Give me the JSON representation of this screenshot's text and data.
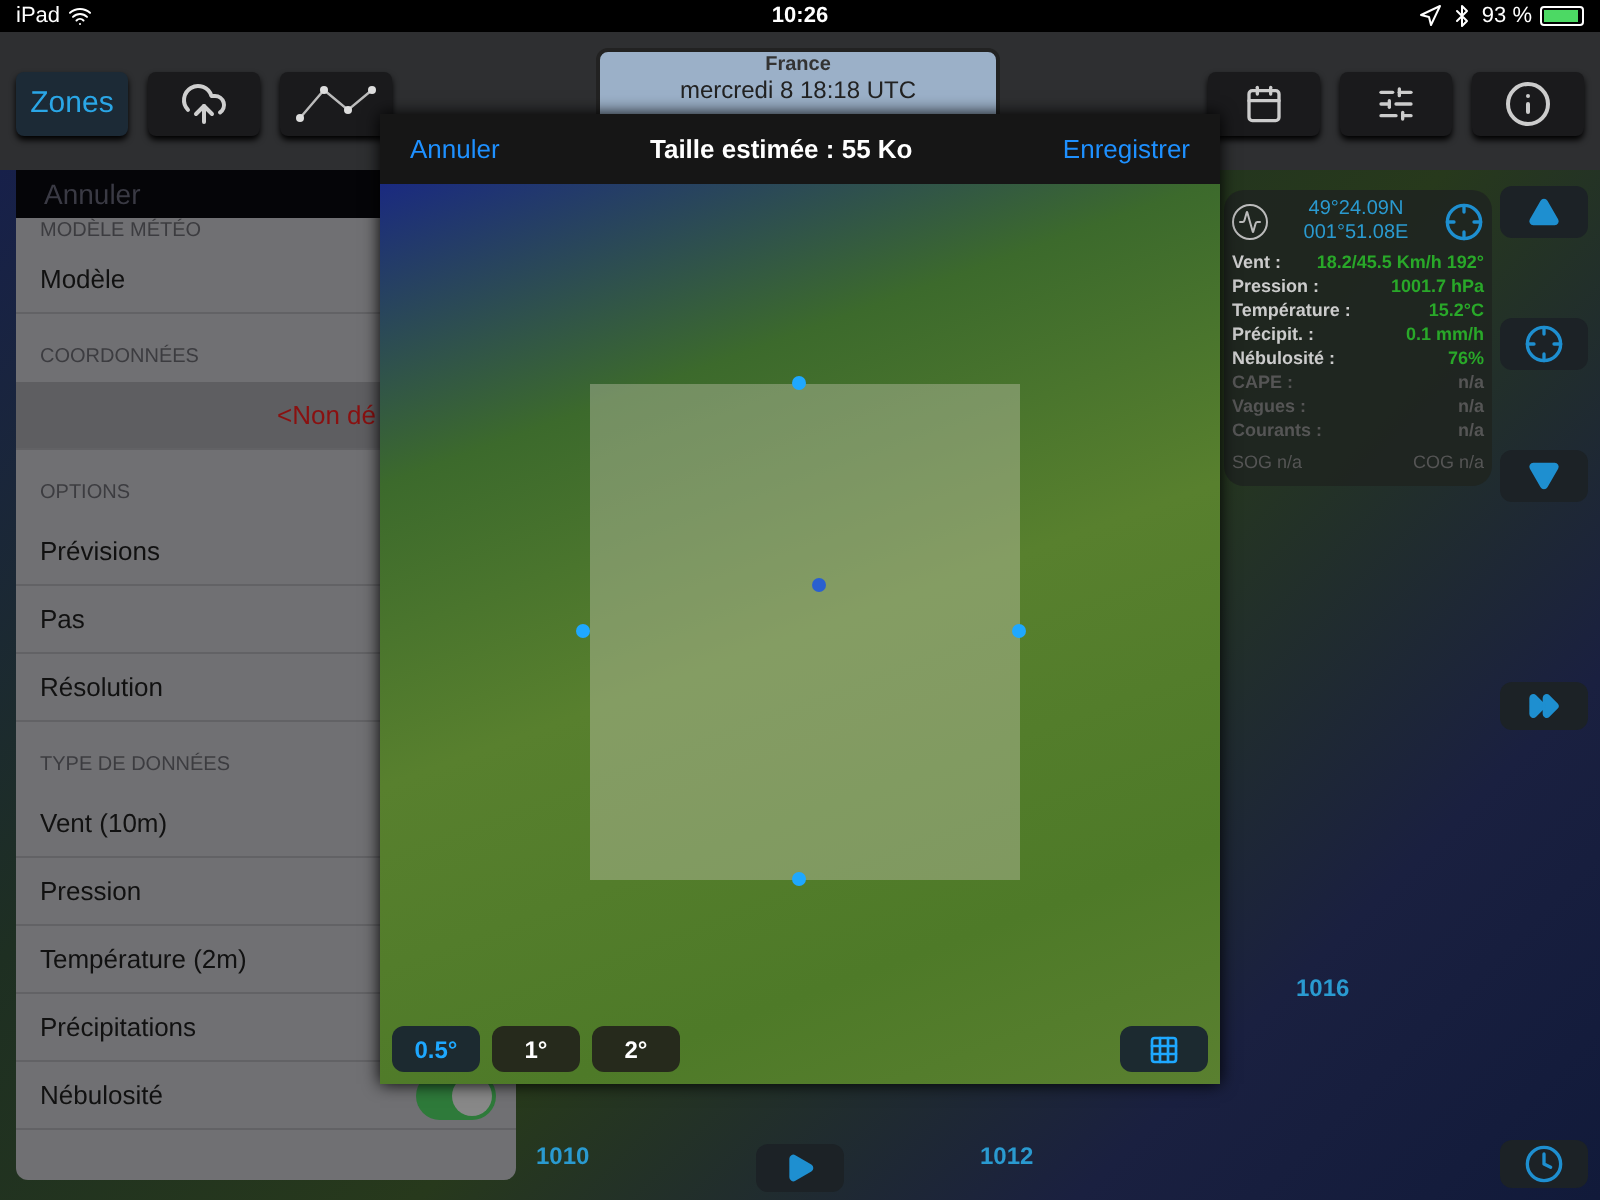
{
  "status_bar": {
    "device": "iPad",
    "time": "10:26",
    "battery": "93 %"
  },
  "toolbar": {
    "left_tabs": [
      {
        "kind": "text",
        "label": "Zones",
        "selected": true
      },
      {
        "kind": "cloud-upload",
        "selected": false
      },
      {
        "kind": "route",
        "selected": false
      }
    ],
    "center": {
      "title": "France",
      "subtitle": "mercredi 8 18:18 UTC"
    },
    "right_buttons": [
      {
        "kind": "calendar"
      },
      {
        "kind": "sliders"
      },
      {
        "kind": "info"
      }
    ]
  },
  "settings_panel": {
    "header": "Annuler",
    "sections": [
      {
        "title": "MODÈLE MÉTÉO",
        "rows": [
          {
            "kind": "plain",
            "label": "Modèle"
          }
        ]
      },
      {
        "title": "COORDONNÉES",
        "rows": [
          {
            "kind": "value",
            "label": "<Non dé"
          }
        ]
      },
      {
        "title": "OPTIONS",
        "rows": [
          {
            "kind": "plain",
            "label": "Prévisions"
          },
          {
            "kind": "plain",
            "label": "Pas"
          },
          {
            "kind": "plain",
            "label": "Résolution"
          }
        ]
      },
      {
        "title": "TYPE DE DONNÉES",
        "rows": [
          {
            "kind": "plain",
            "label": "Vent (10m)"
          },
          {
            "kind": "plain",
            "label": "Pression"
          },
          {
            "kind": "plain",
            "label": "Température (2m)"
          },
          {
            "kind": "plain",
            "label": "Précipitations"
          },
          {
            "kind": "toggle",
            "label": "Nébulosité",
            "on": true
          }
        ]
      }
    ]
  },
  "zone_dialog": {
    "cancel": "Annuler",
    "title": "Taille estimée : 55 Ko",
    "save": "Enregistrer",
    "resolutions": [
      {
        "label": "0.5°",
        "selected": true
      },
      {
        "label": "1°",
        "selected": false
      },
      {
        "label": "2°",
        "selected": false
      }
    ]
  },
  "info_panel": {
    "latitude": "49°24.09N",
    "longitude": "001°51.08E",
    "rows": [
      {
        "label": "Vent :",
        "value": "18.2/45.5 Km/h 192°",
        "available": true
      },
      {
        "label": "Pression :",
        "value": "1001.7 hPa",
        "available": true
      },
      {
        "label": "Température :",
        "value": "15.2°C",
        "available": true
      },
      {
        "label": "Précipit. :",
        "value": "0.1 mm/h",
        "available": true
      },
      {
        "label": "Nébulosité :",
        "value": "76%",
        "available": true
      },
      {
        "label": "CAPE :",
        "value": "n/a",
        "available": false
      },
      {
        "label": "Vagues :",
        "value": "n/a",
        "available": false
      },
      {
        "label": "Courants :",
        "value": "n/a",
        "available": false
      }
    ],
    "sog": "SOG n/a",
    "cog": "COG n/a"
  },
  "map_labels": [
    "1016",
    "1010",
    "1012"
  ]
}
